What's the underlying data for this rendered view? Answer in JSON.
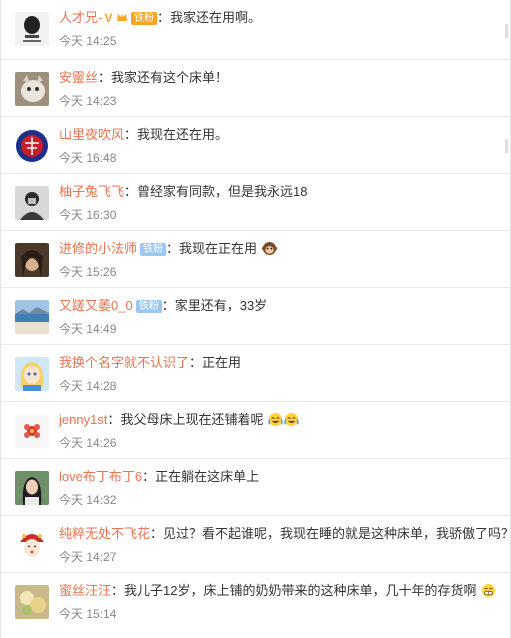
{
  "comments": [
    {
      "user": "人才兄-",
      "has_v": true,
      "badge": "铁粉",
      "badge_style": "gold",
      "text": "我家还在用啊。",
      "time": "今天 14:25",
      "avatar": "ink-portrait",
      "emoji": []
    },
    {
      "user": "安靈丝",
      "text": "我家还有这个床单！",
      "time": "今天 14:23",
      "avatar": "cat-photo",
      "emoji": []
    },
    {
      "user": "山里夜吹风",
      "text": "我现在还在用。",
      "time": "今天 16:48",
      "avatar": "red-blue-emblem",
      "emoji": []
    },
    {
      "user": "柚子兔飞飞",
      "text": "曾经家有同款，但是我永远18",
      "time": "今天 16:30",
      "avatar": "bw-person",
      "emoji": []
    },
    {
      "user": "进修的小法师",
      "badge": "铁粉",
      "badge_style": "fan",
      "text": "我现在正在用",
      "time": "今天 15:26",
      "avatar": "hair-portrait",
      "emoji": [
        "monkey-face-icon"
      ]
    },
    {
      "user": "又蹉又萎0_0",
      "badge": "铁粉",
      "badge_style": "fan",
      "text": "家里还有，33岁",
      "time": "今天 14:49",
      "avatar": "sea-landscape",
      "emoji": []
    },
    {
      "user": "我换个名字就不认识了",
      "text": "正在用",
      "time": "今天 14:28",
      "avatar": "blonde-cartoon",
      "emoji": []
    },
    {
      "user": "jenny1st",
      "text": "我父母床上现在还铺着呢",
      "time": "今天 14:26",
      "avatar": "red-flower",
      "emoji": [
        "laugh-cry-icon",
        "laugh-cry-icon"
      ]
    },
    {
      "user": "love布丁布丁6",
      "text": "正在躺在这床单上",
      "time": "今天 14:32",
      "avatar": "girl-photo",
      "emoji": []
    },
    {
      "user": "纯粹无处不飞花",
      "text": "见过？看不起谁呢，我现在睡的就是这种床单，我骄傲了吗？",
      "time": "今天 14:27",
      "avatar": "opera-cartoon",
      "emoji": []
    },
    {
      "user": "蜜丝汪汪",
      "text": "我儿子12岁，床上铺的奶奶带来的这种床单，几十年的存货啊",
      "time": "今天 15:14",
      "avatar": "food-photo",
      "emoji": [
        "grin-icon"
      ]
    }
  ],
  "colors": {
    "username": "#eb7350",
    "text": "#333333",
    "time": "#888888",
    "fan_badge": "#9cc8f0",
    "gold_badge": "#f6a623"
  }
}
